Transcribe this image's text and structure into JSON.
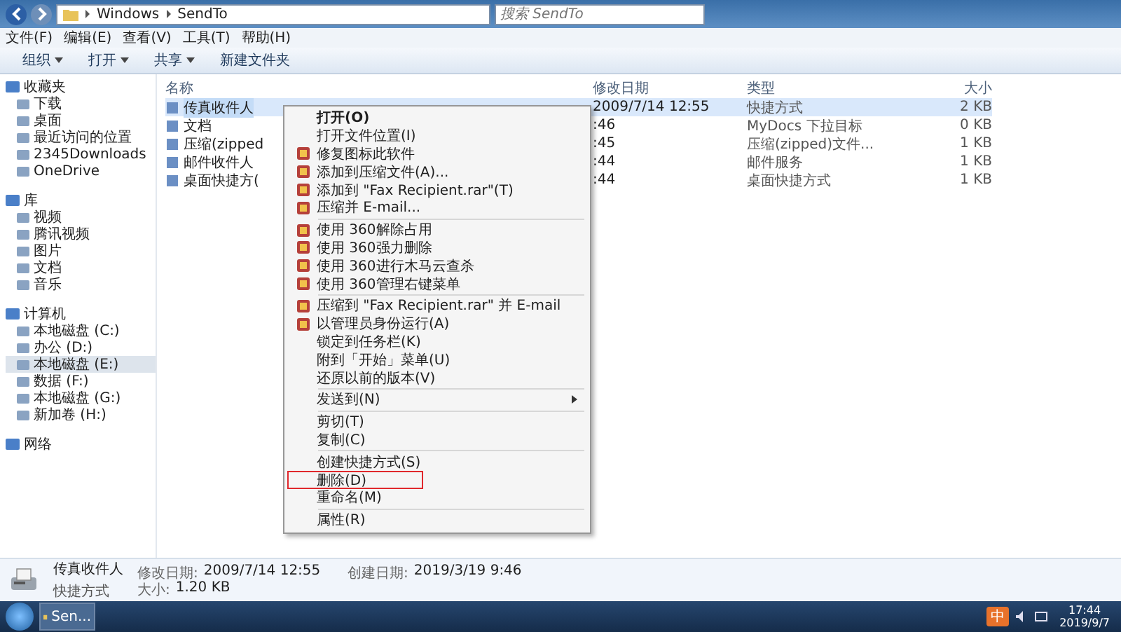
{
  "address": {
    "path": [
      "Windows",
      "SendTo"
    ],
    "search_placeholder": "搜索 SendTo"
  },
  "menubar": [
    "文件(F)",
    "编辑(E)",
    "查看(V)",
    "工具(T)",
    "帮助(H)"
  ],
  "toolbar": [
    {
      "label": "组织",
      "dropdown": true
    },
    {
      "label": "打开",
      "dropdown": true
    },
    {
      "label": "共享",
      "dropdown": true
    },
    {
      "label": "新建文件夹",
      "dropdown": false
    }
  ],
  "sidebar": {
    "groups": [
      {
        "label": "收藏夹",
        "children": [
          {
            "label": "下载",
            "selected": false
          },
          {
            "label": "桌面",
            "selected": false
          },
          {
            "label": "最近访问的位置",
            "selected": false
          },
          {
            "label": "2345Downloads",
            "selected": false
          },
          {
            "label": "OneDrive",
            "selected": false
          }
        ]
      },
      {
        "label": "库",
        "children": [
          {
            "label": "视频",
            "selected": false
          },
          {
            "label": "腾讯视频",
            "selected": false
          },
          {
            "label": "图片",
            "selected": false
          },
          {
            "label": "文档",
            "selected": false
          },
          {
            "label": "音乐",
            "selected": false
          }
        ]
      },
      {
        "label": "计算机",
        "children": [
          {
            "label": "本地磁盘 (C:)",
            "selected": false
          },
          {
            "label": "办公 (D:)",
            "selected": false
          },
          {
            "label": "本地磁盘 (E:)",
            "selected": true
          },
          {
            "label": "数据 (F:)",
            "selected": false
          },
          {
            "label": "本地磁盘 (G:)",
            "selected": false
          },
          {
            "label": "新加卷 (H:)",
            "selected": false
          }
        ]
      },
      {
        "label": "网络"
      }
    ]
  },
  "table": {
    "columns": [
      "名称",
      "修改日期",
      "类型",
      "大小"
    ],
    "rows": [
      {
        "name": "传真收件人",
        "modified": "2009/7/14 12:55",
        "type": "快捷方式",
        "size": "2 KB",
        "selected": true
      },
      {
        "name": "文档",
        "modified": ":46",
        "type": "MyDocs 下拉目标",
        "size": "0 KB",
        "selected": false
      },
      {
        "name": "压缩(zipped",
        "modified": ":45",
        "type": "压缩(zipped)文件...",
        "size": "1 KB",
        "selected": false
      },
      {
        "name": "邮件收件人",
        "modified": ":44",
        "type": "邮件服务",
        "size": "1 KB",
        "selected": false
      },
      {
        "name": "桌面快捷方(",
        "modified": ":44",
        "type": "桌面快捷方式",
        "size": "1 KB",
        "selected": false
      }
    ]
  },
  "context_menu": {
    "items": [
      {
        "kind": "item",
        "label": "打开(O)",
        "default": true,
        "highlighted": false,
        "submenu": false
      },
      {
        "kind": "item",
        "label": "打开文件位置(I)",
        "default": false,
        "highlighted": false,
        "submenu": false
      },
      {
        "kind": "icon_item",
        "label": "修复图标此软件",
        "default": false,
        "highlighted": false,
        "submenu": false
      },
      {
        "kind": "icon_item",
        "label": "添加到压缩文件(A)...",
        "default": false,
        "highlighted": false,
        "submenu": false
      },
      {
        "kind": "icon_item",
        "label": "添加到 \"Fax Recipient.rar\"(T)",
        "default": false,
        "highlighted": false,
        "submenu": false
      },
      {
        "kind": "icon_item",
        "label": "压缩并 E-mail...",
        "default": false,
        "highlighted": false,
        "submenu": false
      },
      {
        "kind": "separator"
      },
      {
        "kind": "icon_item",
        "label": "使用 360解除占用",
        "default": false,
        "highlighted": false,
        "submenu": false
      },
      {
        "kind": "icon_item",
        "label": "使用 360强力删除",
        "default": false,
        "highlighted": false,
        "submenu": false
      },
      {
        "kind": "icon_item",
        "label": "使用 360进行木马云查杀",
        "default": false,
        "highlighted": false,
        "submenu": false
      },
      {
        "kind": "icon_item",
        "label": "使用 360管理右键菜单",
        "default": false,
        "highlighted": false,
        "submenu": false
      },
      {
        "kind": "separator"
      },
      {
        "kind": "icon_item",
        "label": "压缩到 \"Fax Recipient.rar\" 并 E-mail",
        "default": false,
        "highlighted": false,
        "submenu": false
      },
      {
        "kind": "icon_item",
        "label": "以管理员身份运行(A)",
        "default": false,
        "highlighted": false,
        "submenu": false
      },
      {
        "kind": "item",
        "label": "锁定到任务栏(K)",
        "default": false,
        "highlighted": false,
        "submenu": false
      },
      {
        "kind": "item",
        "label": "附到「开始」菜单(U)",
        "default": false,
        "highlighted": false,
        "submenu": false
      },
      {
        "kind": "item",
        "label": "还原以前的版本(V)",
        "default": false,
        "highlighted": false,
        "submenu": false
      },
      {
        "kind": "separator"
      },
      {
        "kind": "item",
        "label": "发送到(N)",
        "default": false,
        "highlighted": false,
        "submenu": true
      },
      {
        "kind": "separator"
      },
      {
        "kind": "item",
        "label": "剪切(T)",
        "default": false,
        "highlighted": false,
        "submenu": false
      },
      {
        "kind": "item",
        "label": "复制(C)",
        "default": false,
        "highlighted": false,
        "submenu": false
      },
      {
        "kind": "separator"
      },
      {
        "kind": "item",
        "label": "创建快捷方式(S)",
        "default": false,
        "highlighted": false,
        "submenu": false
      },
      {
        "kind": "item",
        "label": "删除(D)",
        "default": false,
        "highlighted": true,
        "submenu": false
      },
      {
        "kind": "item",
        "label": "重命名(M)",
        "default": false,
        "highlighted": false,
        "submenu": false
      },
      {
        "kind": "separator"
      },
      {
        "kind": "item",
        "label": "属性(R)",
        "default": false,
        "highlighted": false,
        "submenu": false
      }
    ]
  },
  "details": {
    "name": "传真收件人",
    "type": "快捷方式",
    "fields": [
      {
        "label": "修改日期:",
        "value": "2009/7/14 12:55"
      },
      {
        "label": "大小:",
        "value": "1.20 KB"
      },
      {
        "label": "创建日期:",
        "value": "2019/3/19 9:46"
      }
    ]
  },
  "taskbar": {
    "task": "Sen...",
    "time": "17:44",
    "date": "2019/9/7",
    "ime": "中"
  }
}
